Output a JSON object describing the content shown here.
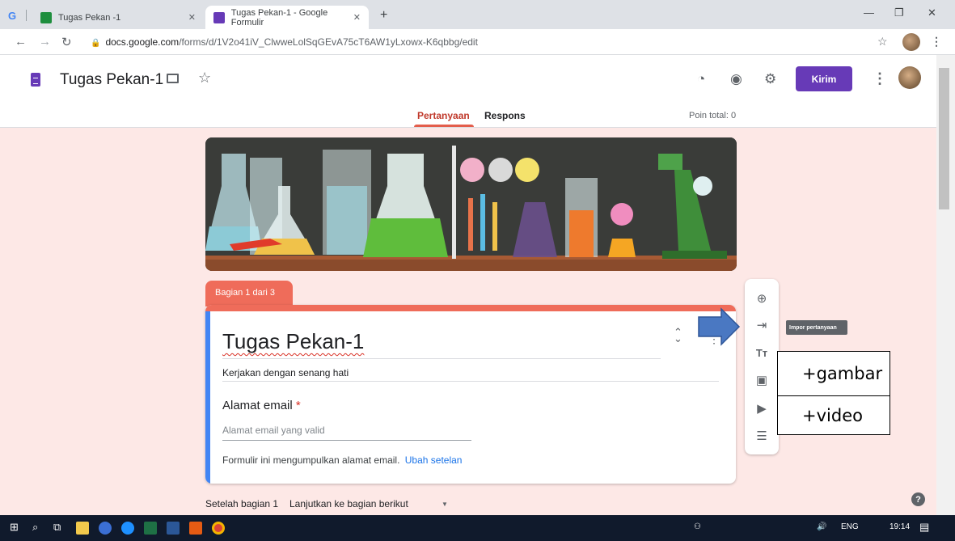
{
  "browser": {
    "tabs": [
      {
        "label": "Tugas Pekan -1",
        "active": false
      },
      {
        "label": "Tugas Pekan-1 - Google Formulir",
        "active": true
      }
    ],
    "new_tab": "+",
    "url_domain": "docs.google.com",
    "url_path": "/forms/d/1V2o41iV_ClwweLolSqGEvA75cT6AW1yLxowx-K6qbbg/edit"
  },
  "header": {
    "doc_title": "Tugas Pekan-1",
    "send_label": "Kirim",
    "tabs": [
      "Pertanyaan",
      "Respons"
    ],
    "points": "Poin total: 0"
  },
  "section": {
    "tab_label": "Bagian 1 dari 3"
  },
  "form": {
    "title": "Tugas Pekan-1",
    "description": "Kerjakan dengan senang hati",
    "email_label": "Alamat email",
    "required_mark": "*",
    "email_placeholder": "Alamat email yang valid",
    "footer_text": "Formulir ini mengumpulkan alamat email.",
    "footer_link": "Ubah setelan"
  },
  "toolbar": {
    "tooltip": "Impor pertanyaan"
  },
  "annotations": {
    "image": "+gambar",
    "video": "+video"
  },
  "after_section": {
    "label": "Setelah bagian 1",
    "value": "Lanjutkan ke bagian berikut"
  },
  "taskbar": {
    "lang": "ENG",
    "time": "19:14"
  },
  "colors": {
    "accent": "#673ab7",
    "theme": "#ef6c5a",
    "background": "#fde8e6"
  }
}
